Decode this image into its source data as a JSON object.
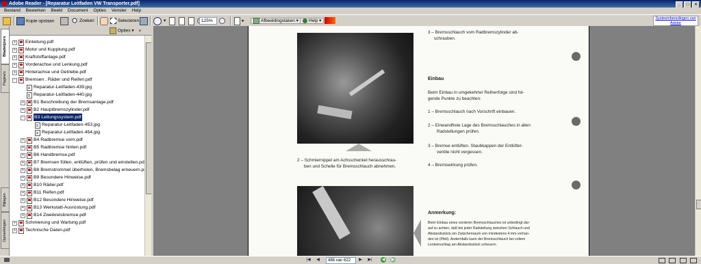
{
  "window": {
    "title": "Adobe Reader - [Reparatur Leitfaden VW Transporter.pdf]"
  },
  "menu": [
    "Bestand",
    "Bewerken",
    "Beeld",
    "Document",
    "Opties",
    "Venster",
    "Help"
  ],
  "toolbar": {
    "save_copy": "Kopie opslaan",
    "search": "Zoeken",
    "select": "Selecteren",
    "zoom": "125%",
    "tasks": "Afbeeldingstaken",
    "help": "Help",
    "adobe_link": "Systeemberedingen van Adobe"
  },
  "left_tabs": [
    "Bladwijzers",
    "Pagina's",
    "Bijlagen",
    "Opmerkingen"
  ],
  "panel": {
    "options": "Opties"
  },
  "bookmarks": [
    {
      "label": "Einleitung.pdf",
      "level": 0,
      "expander": "+",
      "type": "pdf"
    },
    {
      "label": "Motor und Kupplung.pdf",
      "level": 0,
      "expander": "+",
      "type": "pdf"
    },
    {
      "label": "Kraftstoffanlage.pdf",
      "level": 0,
      "expander": "+",
      "type": "pdf"
    },
    {
      "label": "Vorderachse und Lenkung.pdf",
      "level": 0,
      "expander": "+",
      "type": "pdf"
    },
    {
      "label": "Hinterachse und Getriebe.pdf",
      "level": 0,
      "expander": "+",
      "type": "pdf"
    },
    {
      "label": "Bremsen , Räder und Reifen.pdf",
      "level": 0,
      "expander": "−",
      "type": "pdf"
    },
    {
      "label": "Reparatur-Leitfaden-439.jpg",
      "level": 1,
      "expander": "",
      "type": "jpg"
    },
    {
      "label": "Reparatur-Leitfaden-440.jpg",
      "level": 1,
      "expander": "",
      "type": "jpg"
    },
    {
      "label": "B1 Beschreibung der Bremsanlage.pdf",
      "level": 1,
      "expander": "+",
      "type": "pdf"
    },
    {
      "label": "B2 Hauptbremszylinder.pdf",
      "level": 1,
      "expander": "+",
      "type": "pdf"
    },
    {
      "label": "B3 Leitungssystem.pdf",
      "level": 1,
      "expander": "−",
      "type": "pdf",
      "selected": true
    },
    {
      "label": "Reparatur-Leitfaden-453.jpg",
      "level": 2,
      "expander": "",
      "type": "jpg"
    },
    {
      "label": "Reparatur-Leitfaden-454.jpg",
      "level": 2,
      "expander": "",
      "type": "jpg"
    },
    {
      "label": "B4 Radbremse vorn.pdf",
      "level": 1,
      "expander": "+",
      "type": "pdf"
    },
    {
      "label": "B5 Radbremse hinten.pdf",
      "level": 1,
      "expander": "+",
      "type": "pdf"
    },
    {
      "label": "B6 Handbremse.pdf",
      "level": 1,
      "expander": "+",
      "type": "pdf"
    },
    {
      "label": "B7 Bremsen füllen, entlüften, prüfen und einstellen.pdf",
      "level": 1,
      "expander": "+",
      "type": "pdf"
    },
    {
      "label": "B8 Bremstrommel überholen, Bremsbelag erneuern.pdf",
      "level": 1,
      "expander": "+",
      "type": "pdf"
    },
    {
      "label": "B9 Besondere Hinweise.pdf",
      "level": 1,
      "expander": "+",
      "type": "pdf"
    },
    {
      "label": "B10 Räder.pdf",
      "level": 1,
      "expander": "+",
      "type": "pdf"
    },
    {
      "label": "B11 Reifen.pdf",
      "level": 1,
      "expander": "+",
      "type": "pdf"
    },
    {
      "label": "B12 Besondere Hinweise.pdf",
      "level": 1,
      "expander": "+",
      "type": "pdf"
    },
    {
      "label": "B13 Werkstatt-Ausrüstung.pdf",
      "level": 1,
      "expander": "+",
      "type": "pdf"
    },
    {
      "label": "B14 Zweikreisbremse.pdf",
      "level": 1,
      "expander": "+",
      "type": "pdf"
    },
    {
      "label": "Schmierung und Wartung.pdf",
      "level": 0,
      "expander": "+",
      "type": "pdf"
    },
    {
      "label": "Technische Daten.pdf",
      "level": 0,
      "expander": "+",
      "type": "pdf"
    }
  ],
  "document": {
    "step3a": "3 – Bremsschlauch vom Radbremszylinder ab-",
    "step3b": "schrauben.",
    "einbau": "Einbau",
    "intro1": "Beim Einbau in umgekehrter Reihenfolge sind fol-",
    "intro2": "gende Punkte zu beachten:",
    "p1": "1 – Bremsschlauch nach Vorschrift einbauen.",
    "p2a": "2 – Einwandfreie Lage des Bremsschlauches in allen",
    "p2b": "Radstellungen prüfen.",
    "p3a": "3 – Bremse entlüften. Staubkappen der Entlüfter-",
    "p3b": "ventile nicht vergessen.",
    "p4": "4 – Bremswirkung prüfen.",
    "caption1": "2 – Schmiernippel am Achsschenkel herausschrau-",
    "caption2": "ben und Schelle für Bremsschlauch abnehmen.",
    "anmerkung": "Anmerkung:",
    "note1": "Beim Einbau eines vorderen Bremsschlauches ist unbedingt dar-",
    "note2": "auf zu achten, daß bei jeder Radstellung zwischen Schlauch und",
    "note3": "Abstandsstück ein Zwischenraum von mindestens 4 mm vorhan-",
    "note4": "den ist (Pfeil). Andernfalls kann der Bremsschlauch bei vollem",
    "note5": "Lenkeinschlag am Abstandsstück scheuern."
  },
  "status": {
    "page_display": "488 van 622"
  }
}
